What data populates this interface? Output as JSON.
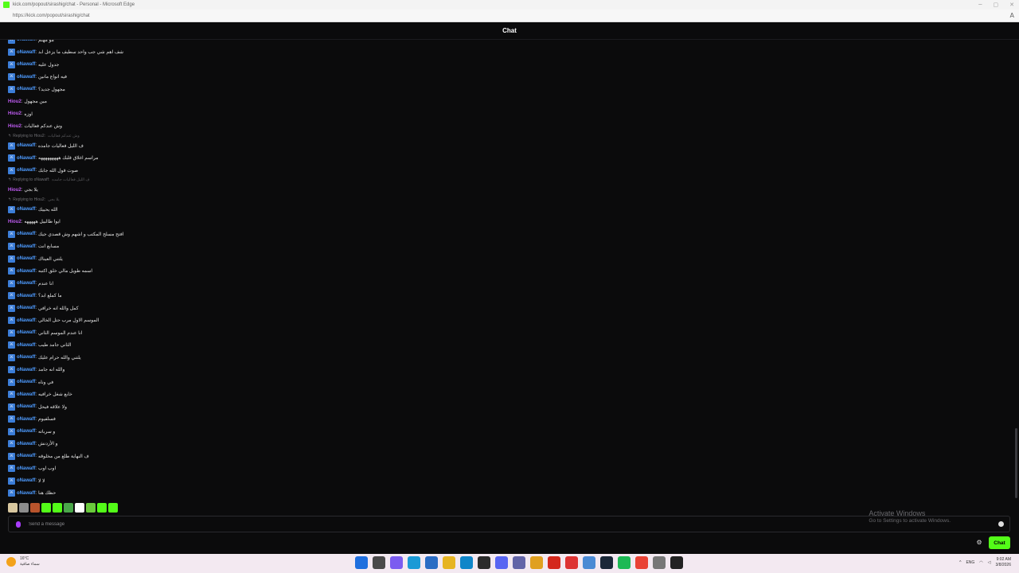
{
  "browser": {
    "window_title": "kick.com/popout/sirashig/chat - Personal - Microsoft Edge",
    "url": "https://kick.com/popout/sirashig/chat"
  },
  "chat": {
    "header": "Chat",
    "messages": [
      {
        "user": "oNawaff",
        "text": "مو مهتم",
        "badge": true
      },
      {
        "user": "oNawaff",
        "text": "شف اهم شي جب واحد سطيف ما يزعل ابد",
        "badge": true
      },
      {
        "user": "oNawaff",
        "text": "جدول عليه",
        "badge": true
      },
      {
        "user": "oNawaff",
        "text": "فيه انواع مانين",
        "badge": true
      },
      {
        "user": "oNawaff",
        "text": "مجهول جديد؟",
        "badge": true
      },
      {
        "user": "Hiou2",
        "text": "مين مجهول",
        "badge": false
      },
      {
        "user": "Hiou2",
        "text": "اوزه",
        "badge": false
      },
      {
        "user": "Hiou2",
        "text": "وش عندكم فعاليات",
        "badge": false
      },
      {
        "user": "oNawaff",
        "text": "ف الليل فعاليات جامده",
        "badge": true,
        "reply": {
          "label": "Replying to Hiou2:",
          "text": "وش عندكم فعاليات"
        }
      },
      {
        "user": "oNawaff",
        "text": "مراسم اغلاق قلبك هههههههههه",
        "badge": true
      },
      {
        "user": "oNawaff",
        "text": "صوت قول الله جابك",
        "badge": true
      },
      {
        "user": "Hiou2",
        "text": "يلا بجي",
        "badge": false,
        "reply": {
          "label": "Replying to oNawaff:",
          "text": "ف الليل فعاليات جامده"
        }
      },
      {
        "user": "oNawaff",
        "text": "الله يحييك",
        "badge": true,
        "reply": {
          "label": "Replying to Hiou2:",
          "text": "يلا بجي"
        }
      },
      {
        "user": "Hiou2",
        "text": "ايوا طالبيل هههههه",
        "badge": false
      },
      {
        "user": "oNawaff",
        "text": "افتح مسلح المكتب و اشهم وش قصدي جيك",
        "badge": true
      },
      {
        "user": "oNawaff",
        "text": "مسابع انت",
        "badge": true
      },
      {
        "user": "oNawaff",
        "text": "يلتني العيناك",
        "badge": true
      },
      {
        "user": "oNawaff",
        "text": "اسمه طويل مالي خلق اكتبه",
        "badge": true
      },
      {
        "user": "oNawaff",
        "text": "انا عندم",
        "badge": true
      },
      {
        "user": "oNawaff",
        "text": "ما كملع ابد؟",
        "badge": true
      },
      {
        "user": "oNawaff",
        "text": "كمل والله انه خرافي",
        "badge": true
      },
      {
        "user": "oNawaff",
        "text": "الموسم الاول مرب حتل الخالي",
        "badge": true
      },
      {
        "user": "oNawaff",
        "text": "انا عندم الموسم الثاني",
        "badge": true
      },
      {
        "user": "oNawaff",
        "text": "الثاني جامد طيب",
        "badge": true
      },
      {
        "user": "oNawaff",
        "text": "يلتني والله حرام عليك",
        "badge": true
      },
      {
        "user": "oNawaff",
        "text": "والله انه جامد",
        "badge": true
      },
      {
        "user": "oNawaff",
        "text": "في وناه",
        "badge": true
      },
      {
        "user": "oNawaff",
        "text": "خابع شغل خرافيه",
        "badge": true
      },
      {
        "user": "oNawaff",
        "text": "ولا علاقه فيحل",
        "badge": true
      },
      {
        "user": "oNawaff",
        "text": "فسلفيوم",
        "badge": true
      },
      {
        "user": "oNawaff",
        "text": "و سرباته",
        "badge": true
      },
      {
        "user": "oNawaff",
        "text": "و الأزدنش",
        "badge": true
      },
      {
        "user": "oNawaff",
        "text": "ف النهاية طلع من مخلوقه",
        "badge": true
      },
      {
        "user": "oNawaff",
        "text": "اوب اوب",
        "badge": true
      },
      {
        "user": "oNawaff",
        "text": "لا لا",
        "badge": true
      },
      {
        "user": "oNawaff",
        "text": "حظك هنا",
        "badge": true
      }
    ],
    "input": {
      "placeholder": "Send a message"
    },
    "send_label": "Chat",
    "emotes": [
      "#d9c8a0",
      "#8d8d8d",
      "#b8542c",
      "#53fc18",
      "#53fc18",
      "#4aa84a",
      "#ffffff",
      "#6aca3c",
      "#53fc18",
      "#53fc18"
    ]
  },
  "activation": {
    "title": "Activate Windows",
    "subtitle": "Go to Settings to activate Windows."
  },
  "taskbar": {
    "weather_temp": "16°C",
    "weather_desc": "سماء صافية",
    "language": "ENG",
    "time": "9:02 AM",
    "date": "3/8/2026",
    "apps": [
      {
        "name": "start",
        "color": "#1f6fde"
      },
      {
        "name": "search",
        "color": "#4a4a4a"
      },
      {
        "name": "copilot",
        "color": "#7b5cf0"
      },
      {
        "name": "edge",
        "color": "#1a9ad6"
      },
      {
        "name": "store",
        "color": "#2a6cc4"
      },
      {
        "name": "explorer",
        "color": "#e6b422"
      },
      {
        "name": "edge-active",
        "color": "#0f86c9"
      },
      {
        "name": "terminal",
        "color": "#2b2b2b"
      },
      {
        "name": "discord",
        "color": "#5865f2"
      },
      {
        "name": "teams",
        "color": "#6264a7"
      },
      {
        "name": "folder",
        "color": "#e0a020"
      },
      {
        "name": "acrobat",
        "color": "#d4281c"
      },
      {
        "name": "anki",
        "color": "#d33"
      },
      {
        "name": "snip",
        "color": "#4a8ad4"
      },
      {
        "name": "steam",
        "color": "#1b2838"
      },
      {
        "name": "spotify",
        "color": "#1db954"
      },
      {
        "name": "chrome",
        "color": "#e94235"
      },
      {
        "name": "settings",
        "color": "#777"
      },
      {
        "name": "cmd",
        "color": "#222"
      }
    ]
  }
}
